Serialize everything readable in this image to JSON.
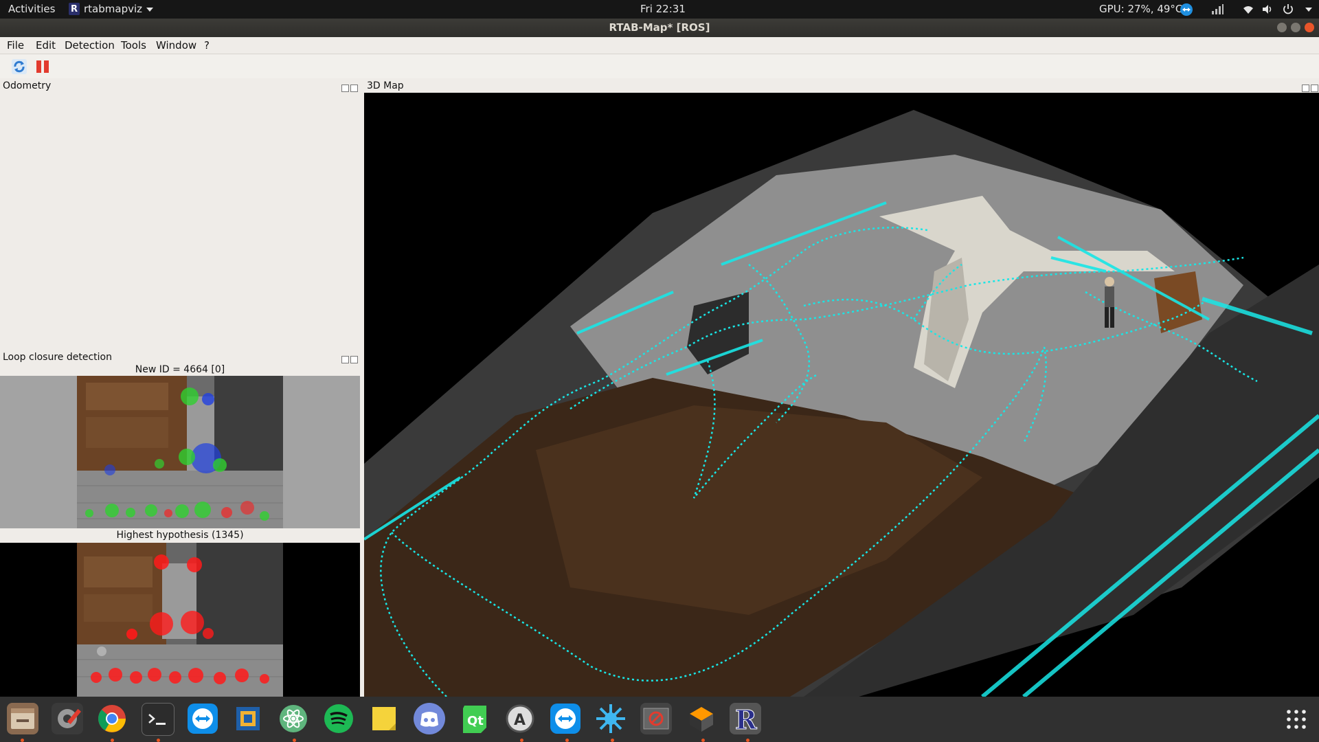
{
  "top_bar": {
    "activities": "Activities",
    "app_name": "rtabmapviz",
    "clock": "Fri 22:31",
    "gpu_status": "GPU: 27%, 49°C"
  },
  "window": {
    "title": "RTAB-Map* [ROS]"
  },
  "menu": [
    "File",
    "Edit",
    "Detection",
    "Tools",
    "Window",
    "?"
  ],
  "toolbar": {
    "icons": [
      "refresh-icon",
      "pause-icon"
    ]
  },
  "docks": {
    "odometry": {
      "title": "Odometry"
    },
    "loop_closure": {
      "title": "Loop closure detection",
      "new_id_label": "New ID = 4664 [0]",
      "hypothesis_label": "Highest hypothesis (1345)"
    },
    "map3d": {
      "title": "3D Map"
    }
  },
  "dock_apps": [
    "files-icon",
    "settings-icon",
    "chrome-icon",
    "terminal-icon",
    "teamviewer-icon",
    "virtualbox-icon",
    "atom-icon",
    "spotify-icon",
    "sticky-notes-icon",
    "discord-icon",
    "qt-creator-icon",
    "software-updater-icon",
    "teamviewer-icon-2",
    "splash-icon",
    "blocked-icon",
    "sublime-icon",
    "rtabmap-icon",
    "show-apps-icon"
  ],
  "colors": {
    "accent_orange": "#e95420",
    "trajectory_cyan": "#19e6e6",
    "feature_green": "#30d030",
    "feature_red": "#ff1a1a",
    "feature_blue": "#2040e0"
  }
}
